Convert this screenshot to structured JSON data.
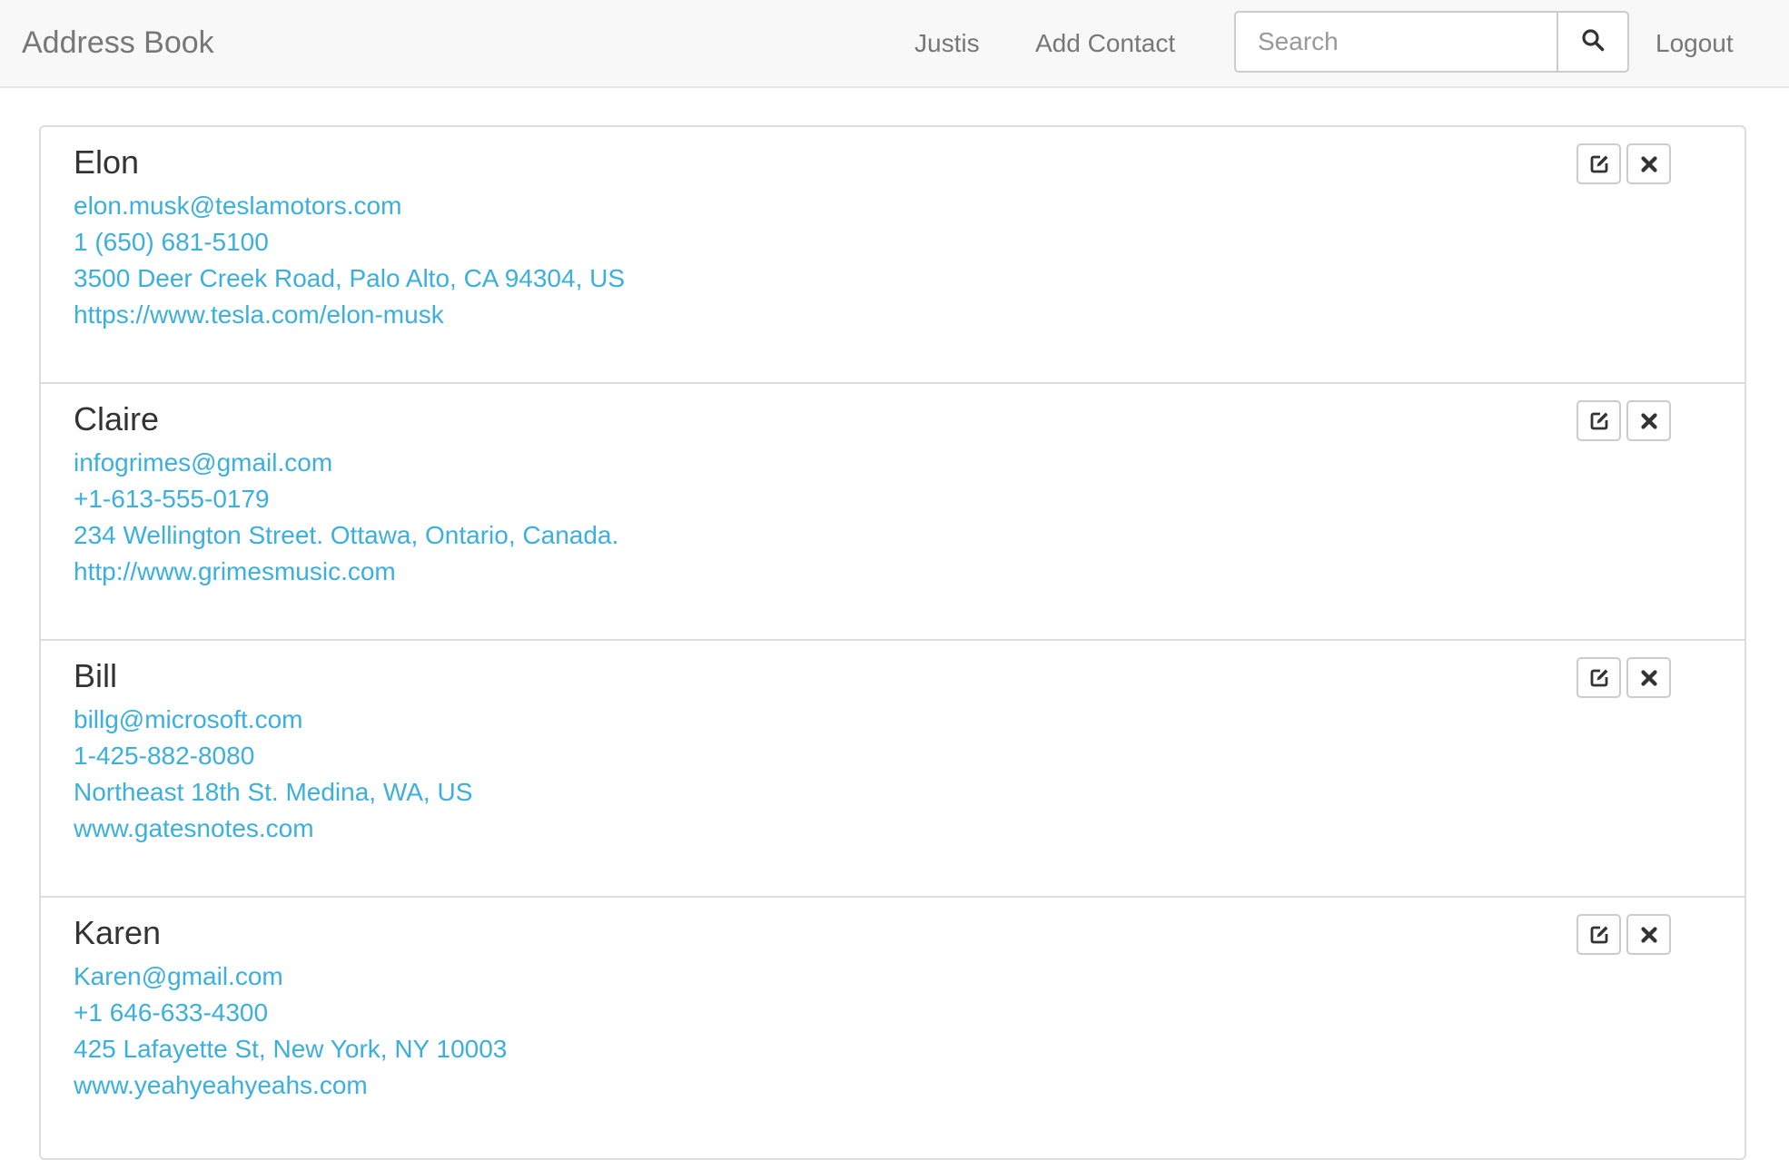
{
  "navbar": {
    "brand": "Address Book",
    "user_label": "Justis",
    "add_contact_label": "Add Contact",
    "search": {
      "placeholder": "Search",
      "value": ""
    },
    "logout_label": "Logout"
  },
  "contacts": [
    {
      "name": "Elon",
      "email": "elon.musk@teslamotors.com",
      "phone": "1 (650) 681-5100",
      "address": "3500 Deer Creek Road, Palo Alto, CA 94304, US",
      "website": "https://www.tesla.com/elon-musk"
    },
    {
      "name": "Claire",
      "email": "infogrimes@gmail.com",
      "phone": "+1-613-555-0179",
      "address": "234 Wellington Street. Ottawa, Ontario, Canada.",
      "website": "http://www.grimesmusic.com"
    },
    {
      "name": "Bill",
      "email": "billg@microsoft.com",
      "phone": "1-425-882-8080",
      "address": "Northeast 18th St. Medina, WA, US",
      "website": "www.gatesnotes.com"
    },
    {
      "name": "Karen",
      "email": "Karen@gmail.com",
      "phone": "+1 646-633-4300",
      "address": "425 Lafayette St, New York, NY 10003",
      "website": "www.yeahyeahyeahs.com"
    }
  ],
  "icons": {
    "search": "search-icon",
    "edit": "edit-icon",
    "delete": "close-icon"
  },
  "colors": {
    "link": "#3bb0dc",
    "navbar_bg": "#f8f8f8",
    "nav_text": "#777777",
    "border": "#dddddd"
  }
}
